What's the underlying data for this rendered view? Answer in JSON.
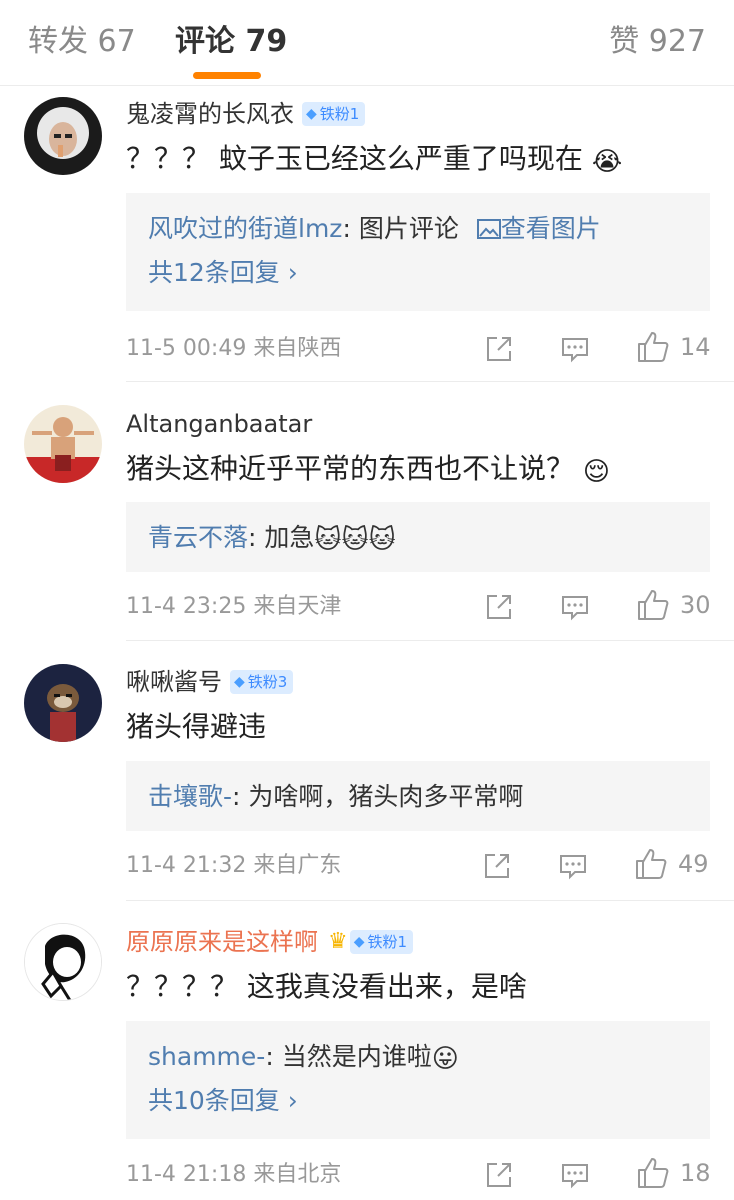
{
  "tabs": {
    "repost": "转发 67",
    "comments": "评论 79",
    "likes": "赞 927"
  },
  "colors": {
    "accent": "#ff8200",
    "link": "#507daf",
    "badge_bg": "#dcecff",
    "username_highlight": "#eb7350"
  },
  "comments": [
    {
      "username": "鬼凌霄的长风衣",
      "badge": "铁粉1",
      "text": "？？？ 蚊子玉已经这么严重了吗现在",
      "emoji": "😭",
      "reply": {
        "author": "风吹过的街道lmz",
        "sep": ": ",
        "text": "图片评论",
        "link": "查看图片",
        "more": "共12条回复 ›"
      },
      "time": "11-5 00:49",
      "location": "来自陕西",
      "like_count": "14"
    },
    {
      "username": "Altanganbaatar",
      "text": "猪头这种近乎平常的东西也不让说？",
      "emoji": "😌",
      "reply": {
        "author": "青云不落",
        "sep": ": ",
        "text": "加急",
        "emoji": "🐱🐱🐱"
      },
      "time": "11-4 23:25",
      "location": "来自天津",
      "like_count": "30"
    },
    {
      "username": "啾啾酱号",
      "badge": "铁粉3",
      "text": "猪头得避违",
      "reply": {
        "author": "击壤歌-",
        "sep": ": ",
        "text": "为啥啊，猪头肉多平常啊"
      },
      "time": "11-4 21:32",
      "location": "来自广东",
      "like_count": "49"
    },
    {
      "username": "原原原来是这样啊",
      "badge": "铁粉1",
      "text": "？？？？ 这我真没看出来，是啥",
      "reply": {
        "author": "shamme-",
        "sep": ": ",
        "text": "当然是内谁啦",
        "emoji": "😛",
        "more": "共10条回复 ›"
      },
      "time": "11-4 21:18",
      "location": "来自北京",
      "like_count": "18"
    }
  ],
  "icons": {
    "share": "share-icon",
    "comment": "comment-icon",
    "like": "thumbs-up-icon",
    "picture": "picture-icon",
    "badge_gem": "diamond-icon",
    "crown": "crown-icon"
  }
}
